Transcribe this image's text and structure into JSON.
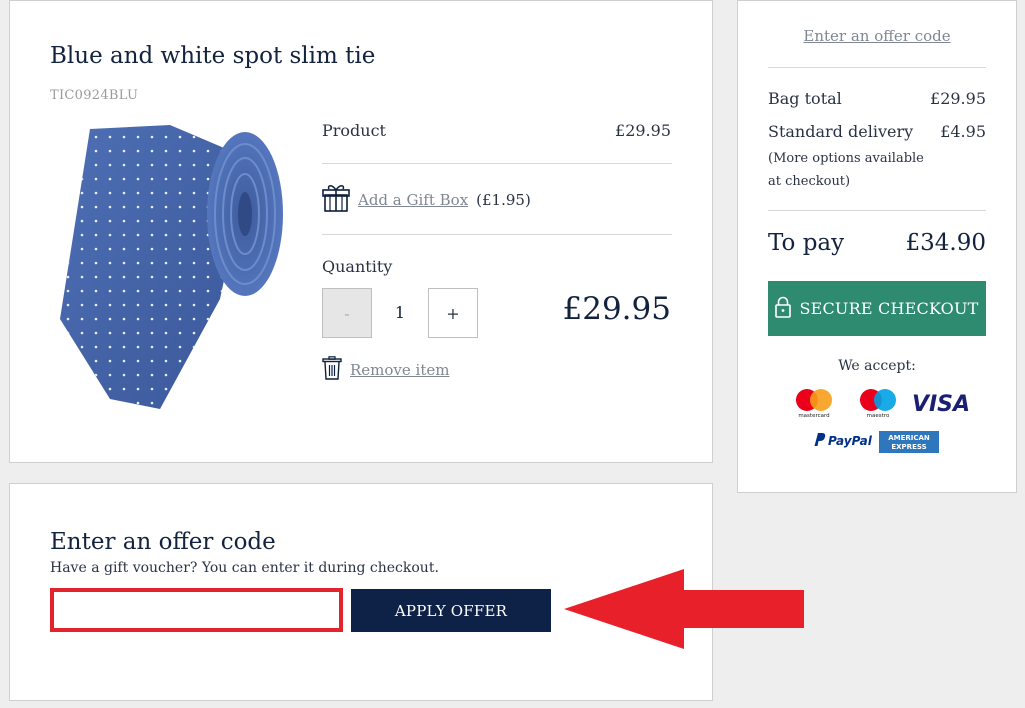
{
  "product": {
    "title": "Blue and white spot slim tie",
    "sku": "TIC0924BLU",
    "image_icon": "tie-image",
    "product_label": "Product",
    "product_price": "£29.95",
    "gift_icon": "gift-box-icon",
    "gift_label": "Add a Gift Box",
    "gift_price": "(£1.95)",
    "quantity_label": "Quantity",
    "minus_label": "-",
    "quantity_value": "1",
    "plus_label": "+",
    "line_total": "£29.95",
    "remove_icon": "trash-icon",
    "remove_label": "Remove item"
  },
  "summary": {
    "offer_link": "Enter an offer code",
    "bag_total_label": "Bag total",
    "bag_total_value": "£29.95",
    "delivery_label": "Standard delivery",
    "delivery_value": "£4.95",
    "delivery_note": "(More options available at checkout)",
    "to_pay_label": "To pay",
    "to_pay_value": "£34.90",
    "checkout_icon": "lock-icon",
    "checkout_label": "SECURE CHECKOUT",
    "accept_label": "We accept:",
    "payment_methods": [
      "mastercard",
      "maestro",
      "VISA",
      "PayPal",
      "AMERICAN EXPRESS"
    ]
  },
  "offer": {
    "title": "Enter an offer code",
    "subtitle": "Have a gift voucher? You can enter it during checkout.",
    "input_value": "",
    "apply_label": "APPLY OFFER"
  },
  "colors": {
    "navy": "#0e2147",
    "green": "#2e8b6f",
    "highlight_red": "#e2242c",
    "background": "#efeeee"
  }
}
